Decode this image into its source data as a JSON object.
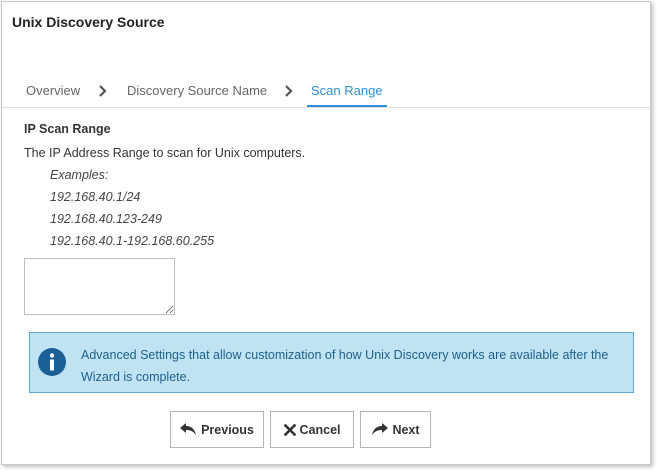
{
  "window": {
    "title": "Unix Discovery Source"
  },
  "tabs": [
    {
      "label": "Overview",
      "active": false
    },
    {
      "label": "Discovery Source Name",
      "active": false
    },
    {
      "label": "Scan Range",
      "active": true
    }
  ],
  "section": {
    "label": "IP Scan Range",
    "description": "The IP Address Range to scan for Unix computers.",
    "examples_heading": "Examples:",
    "examples": [
      "192.168.40.1/24",
      "192.168.40.123-249",
      "192.168.40.1-192.168.60.255"
    ],
    "range_value": ""
  },
  "info": {
    "text": "Advanced Settings that allow customization of how Unix Discovery works are available after the Wizard is complete.",
    "icon": "info-icon"
  },
  "buttons": {
    "previous": "Previous",
    "cancel": "Cancel",
    "next": "Next"
  },
  "colors": {
    "accent": "#2d8fd5",
    "info_bg": "#bfe3f3",
    "info_border": "#5aa9d6",
    "info_icon": "#1a5f95"
  }
}
